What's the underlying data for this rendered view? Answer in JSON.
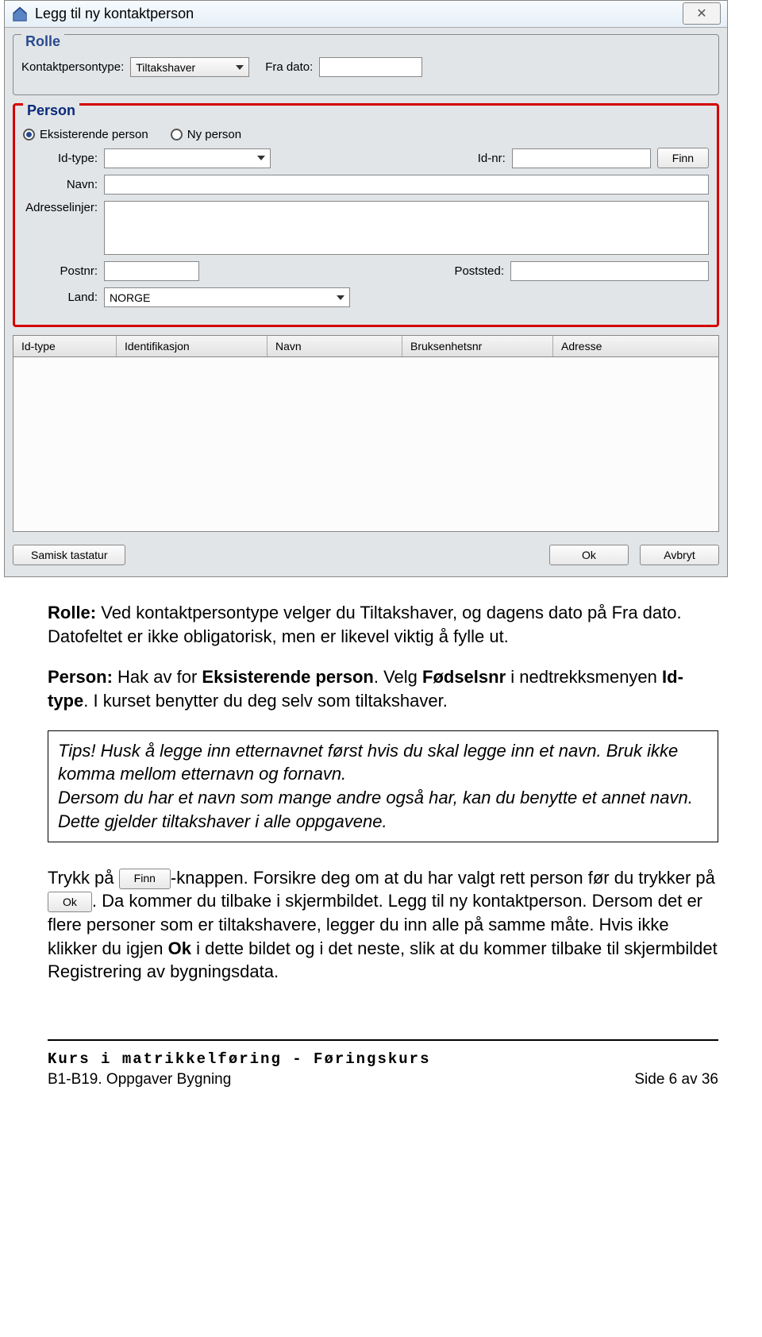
{
  "dialog": {
    "title": "Legg til ny kontaktperson",
    "close_glyph": "✕",
    "rolle": {
      "legend": "Rolle",
      "kontaktpersontype_label": "Kontaktpersontype:",
      "kontaktpersontype_value": "Tiltakshaver",
      "fradato_label": "Fra dato:",
      "fradato_value": ""
    },
    "person": {
      "legend": "Person",
      "radio_existing": "Eksisterende person",
      "radio_new": "Ny person",
      "idtype_label": "Id-type:",
      "idtype_value": "",
      "idnr_label": "Id-nr:",
      "idnr_value": "",
      "finn_btn": "Finn",
      "navn_label": "Navn:",
      "adresselinjer_label": "Adresselinjer:",
      "postnr_label": "Postnr:",
      "postnr_value": "",
      "poststed_label": "Poststed:",
      "poststed_value": "",
      "land_label": "Land:",
      "land_value": "NORGE"
    },
    "table_headers": [
      "Id-type",
      "Identifikasjon",
      "Navn",
      "Bruksenhetsnr",
      "Adresse"
    ],
    "buttons": {
      "samisk": "Samisk tastatur",
      "ok": "Ok",
      "avbryt": "Avbryt"
    }
  },
  "doc": {
    "p1_pre": "Rolle:",
    "p1_rest": " Ved kontaktpersontype velger du Tiltakshaver, og dagens dato på Fra dato. Datofeltet er ikke obligatorisk, men er likevel viktig å fylle ut.",
    "p2_pre": "Person:",
    "p2_mid": " Hak av for ",
    "p2_bold2": "Eksisterende person",
    "p2_mid2": ". Velg ",
    "p2_bold3": "Fødselsnr",
    "p2_mid3": " i nedtrekksmenyen ",
    "p2_bold4": "Id-type",
    "p2_rest": ". I kurset benytter du deg selv som tiltakshaver.",
    "tips": "Tips! Husk å legge inn etternavnet først hvis du skal legge inn et navn. Bruk ikke komma mellom etternavn og fornavn.\nDersom du har et navn som mange andre også har, kan du benytte et annet navn. Dette gjelder tiltakshaver i alle oppgavene.",
    "p3_a": "Trykk på ",
    "p3_finn": "Finn",
    "p3_b": "-knappen. Forsikre deg om at du har valgt rett person før du trykker på ",
    "p3_ok": "Ok",
    "p3_c": ". Da kommer du tilbake i skjermbildet. Legg til ny kontaktperson. Dersom det er flere personer som er tiltakshavere, legger du inn alle på samme måte. Hvis ikke klikker du igjen ",
    "p3_okbold": "Ok",
    "p3_d": " i dette bildet og i det neste, slik at du kommer tilbake til skjermbildet Registrering av bygningsdata.",
    "footer_line1": "Kurs i matrikkelføring - Føringskurs",
    "footer_line2_left": "B1-B19. Oppgaver Bygning",
    "footer_line2_right": "Side 6 av 36"
  }
}
